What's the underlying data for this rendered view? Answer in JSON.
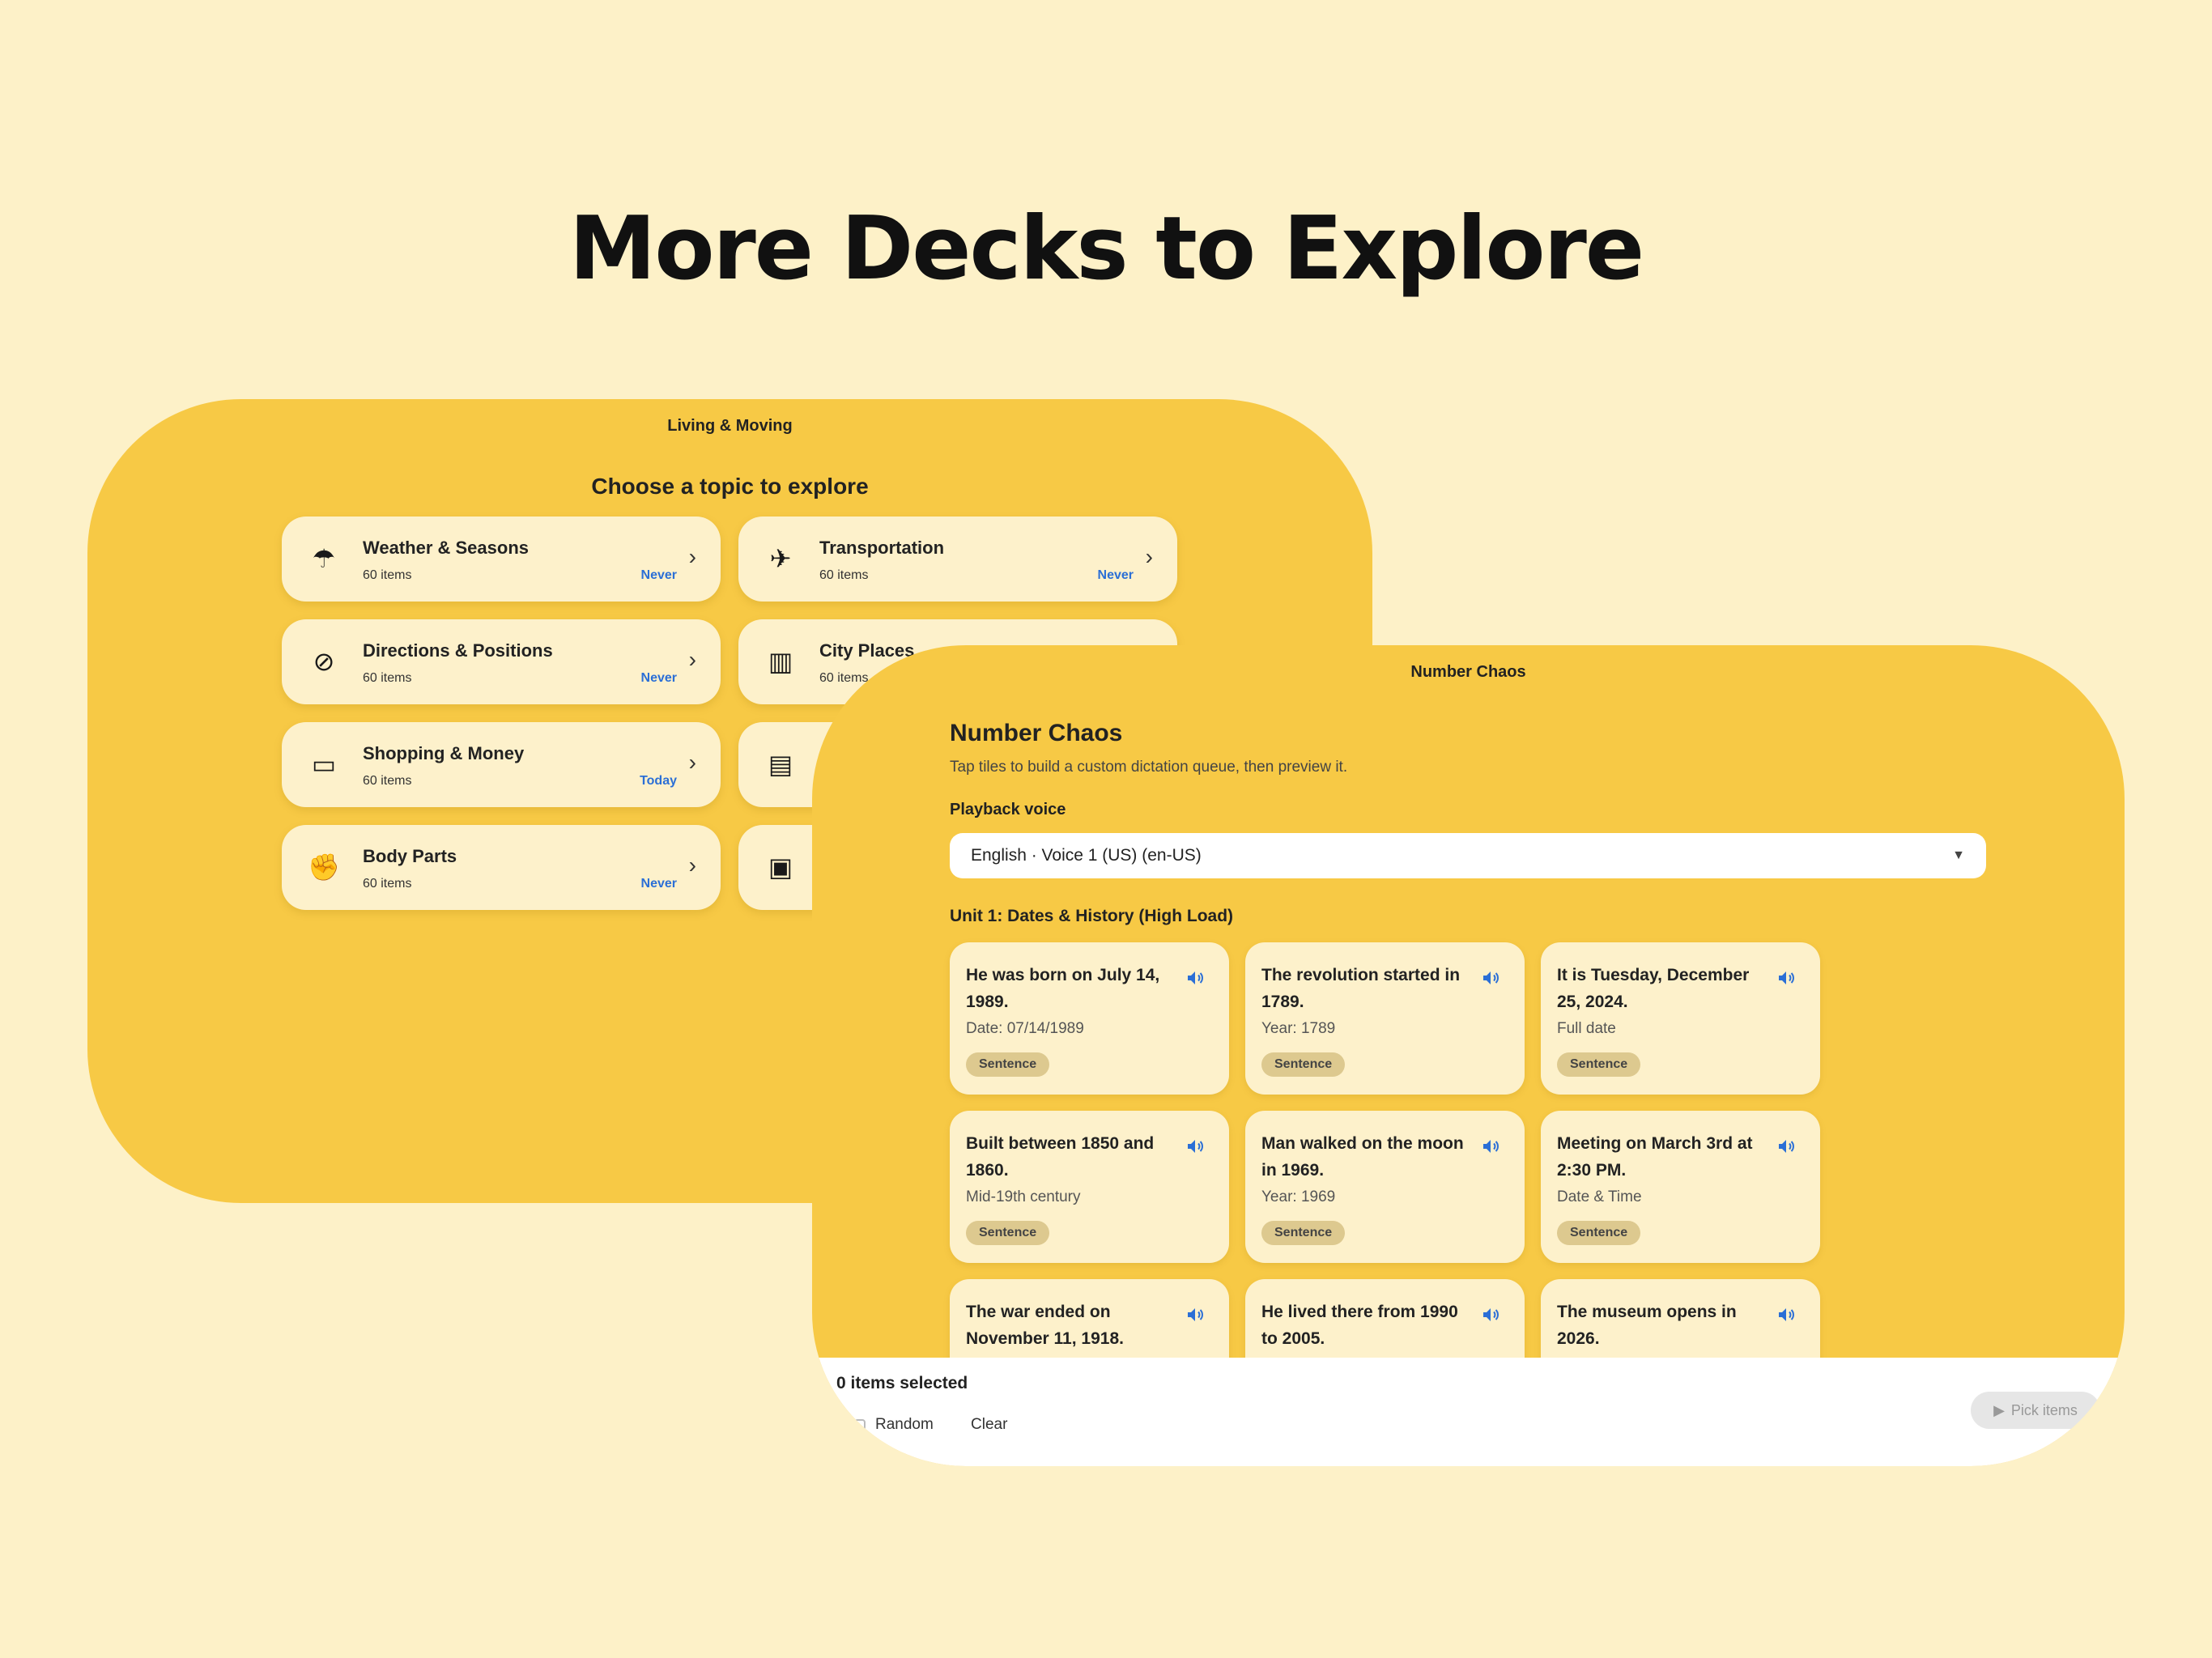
{
  "headline": "More Decks to Explore",
  "deck_screen": {
    "title": "Living & Moving",
    "subtitle": "Choose a topic to explore",
    "topics": [
      {
        "name": "Weather & Seasons",
        "count": "60 items",
        "status": "Never",
        "icon": "umbrella-icon",
        "glyph": "☂"
      },
      {
        "name": "Transportation",
        "count": "60 items",
        "status": "Never",
        "icon": "airplane-icon",
        "glyph": "✈"
      },
      {
        "name": "Directions & Positions",
        "count": "60 items",
        "status": "Never",
        "icon": "compass-icon",
        "glyph": "⊘"
      },
      {
        "name": "City Places",
        "count": "60 items",
        "status": "",
        "icon": "city-icon",
        "glyph": "▥"
      },
      {
        "name": "Shopping & Money",
        "count": "60 items",
        "status": "Today",
        "icon": "money-icon",
        "glyph": "▭"
      },
      {
        "name": "",
        "count": "",
        "status": "",
        "icon": "luggage-icon",
        "glyph": "▤"
      },
      {
        "name": "Body Parts",
        "count": "60 items",
        "status": "Never",
        "icon": "arm-icon",
        "glyph": "✊"
      },
      {
        "name": "",
        "count": "",
        "status": "",
        "icon": "bus-icon",
        "glyph": "▣"
      }
    ]
  },
  "number_screen": {
    "title": "Number Chaos",
    "heading": "Number Chaos",
    "description": "Tap tiles to build a custom dictation queue, then preview it.",
    "voice_label": "Playback voice",
    "voice_value": "English · Voice 1 (US) (en-US)",
    "unit_label": "Unit 1: Dates & History (High Load)",
    "cards": [
      {
        "sentence": "He was born on July 14, 1989.",
        "meta": "Date: 07/14/1989",
        "badge": "Sentence"
      },
      {
        "sentence": "The revolution started in 1789.",
        "meta": "Year: 1789",
        "badge": "Sentence"
      },
      {
        "sentence": "It is Tuesday, December 25, 2024.",
        "meta": "Full date",
        "badge": "Sentence"
      },
      {
        "sentence": "Built between 1850 and 1860.",
        "meta": "Mid-19th century",
        "badge": "Sentence"
      },
      {
        "sentence": "Man walked on the moon in 1969.",
        "meta": "Year: 1969",
        "badge": "Sentence"
      },
      {
        "sentence": "Meeting on March 3rd at 2:30 PM.",
        "meta": "Date & Time",
        "badge": "Sentence"
      },
      {
        "sentence": "The war ended on November 11, 1918.",
        "meta": "",
        "badge": ""
      },
      {
        "sentence": "He lived there from 1990 to 2005.",
        "meta": "",
        "badge": ""
      },
      {
        "sentence": "The museum opens in 2026.",
        "meta": "",
        "badge": ""
      }
    ],
    "selected_count": "0 items selected",
    "random_label": "Random",
    "clear_label": "Clear",
    "pick_label": "Pick items"
  },
  "colors": {
    "background": "#fdf1c8",
    "device": "#f7c945",
    "card": "#fdf1cb",
    "status_blue": "#2b6fd6",
    "speaker_blue": "#2b6fd6"
  }
}
